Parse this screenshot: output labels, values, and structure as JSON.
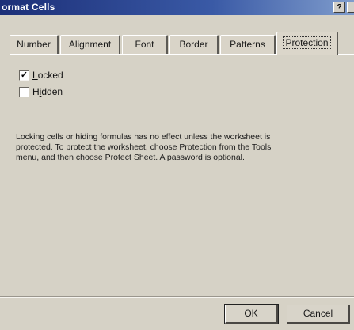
{
  "window": {
    "title": "ormat Cells",
    "help_button": "?"
  },
  "tabs": [
    {
      "label": "Number",
      "active": false
    },
    {
      "label": "Alignment",
      "active": false
    },
    {
      "label": "Font",
      "active": false
    },
    {
      "label": "Border",
      "active": false
    },
    {
      "label": "Patterns",
      "active": false
    },
    {
      "label": "Protection",
      "active": true
    }
  ],
  "protection": {
    "locked": {
      "label": "Locked",
      "mnemonic": "L",
      "checked": true
    },
    "hidden": {
      "label": "Hidden",
      "mnemonic": "i",
      "checked": false
    },
    "info_text": "Locking cells or hiding formulas has no effect unless the worksheet is protected. To protect the worksheet, choose Protection from the Tools menu, and then choose Protect Sheet. A password is optional."
  },
  "buttons": {
    "ok": "OK",
    "cancel": "Cancel"
  }
}
